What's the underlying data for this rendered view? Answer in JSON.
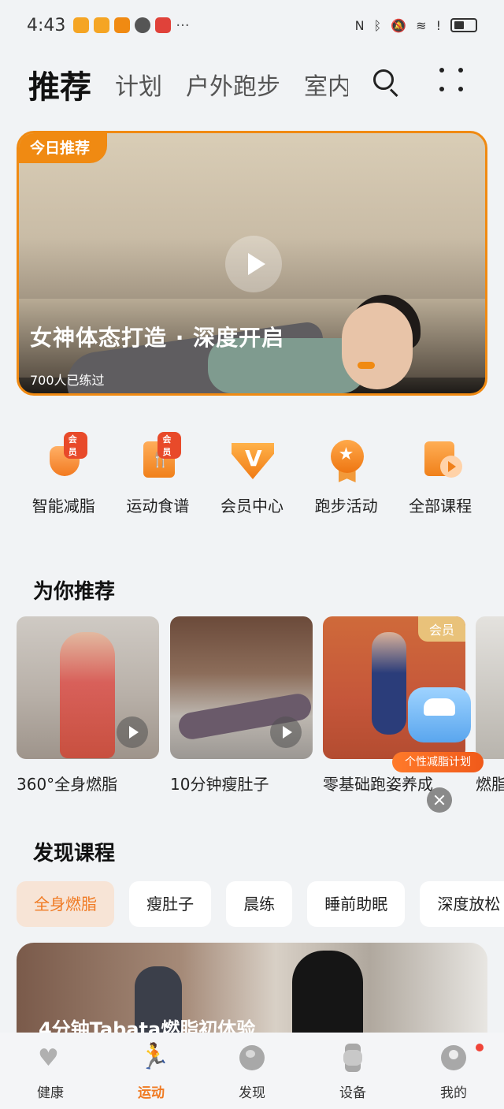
{
  "status_bar": {
    "time": "4:43",
    "more": "···",
    "notif_colors": [
      "#f5a524",
      "#f5a524",
      "#f08a12",
      "#555555",
      "#e0423a"
    ]
  },
  "top_tabs": {
    "items": [
      "推荐",
      "计划",
      "户外跑步",
      "室内"
    ],
    "active_index": 0,
    "search_icon": "search-icon",
    "more_icon": "grid-dots-icon"
  },
  "hero": {
    "badge": "今日推荐",
    "title": "女神体态打造 · 深度开启",
    "subtitle": "700人已练过",
    "accent": "#f08a12"
  },
  "quick_entries": [
    {
      "label": "智能减脂",
      "icon": "fat-burn-icon",
      "tag": "会员"
    },
    {
      "label": "运动食谱",
      "icon": "recipe-icon",
      "tag": "会员"
    },
    {
      "label": "会员中心",
      "icon": "vip-icon",
      "tag": ""
    },
    {
      "label": "跑步活动",
      "icon": "medal-icon",
      "tag": ""
    },
    {
      "label": "全部课程",
      "icon": "course-icon",
      "tag": ""
    }
  ],
  "recommend": {
    "title": "为你推荐",
    "cards": [
      {
        "title": "360°全身燃脂",
        "vip": ""
      },
      {
        "title": "10分钟瘦肚子",
        "vip": ""
      },
      {
        "title": "零基础跑姿养成",
        "vip": "会员"
      },
      {
        "title": "燃脂",
        "vip": ""
      }
    ],
    "promo_label": "个性减脂计划"
  },
  "discover": {
    "title": "发现课程",
    "chips": [
      "全身燃脂",
      "瘦肚子",
      "晨练",
      "睡前助眠",
      "深度放松"
    ],
    "active_chip": 0,
    "banner_title": "4分钟Tabata燃脂初体验"
  },
  "bottom_nav": [
    {
      "label": "健康",
      "icon": "heart-icon"
    },
    {
      "label": "运动",
      "icon": "runner-icon"
    },
    {
      "label": "发现",
      "icon": "globe-icon"
    },
    {
      "label": "设备",
      "icon": "watch-icon"
    },
    {
      "label": "我的",
      "icon": "profile-icon"
    }
  ],
  "bottom_nav_active": 1
}
